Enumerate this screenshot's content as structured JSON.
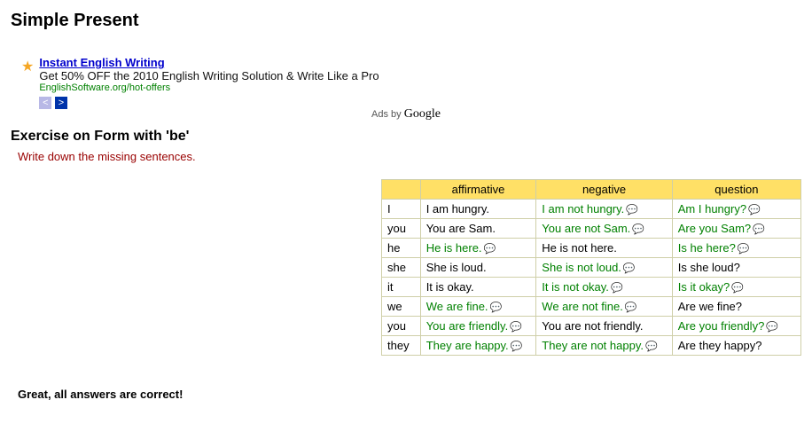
{
  "page": {
    "title": "Simple Present",
    "subtitle": "Exercise on Form with 'be'",
    "instruction": "Write down the missing sentences.",
    "result": "Great, all answers are correct!"
  },
  "ad": {
    "title": "Instant English Writing",
    "desc": "Get 50% OFF the 2010 English Writing Solution & Write Like a Pro",
    "url": "EnglishSoftware.org/hot-offers",
    "prev": "<",
    "next": ">",
    "ads_by_prefix": "Ads by ",
    "ads_by_brand": "Google"
  },
  "table": {
    "headers": {
      "aff": "affirmative",
      "neg": "negative",
      "q": "question"
    },
    "rows": [
      {
        "p": "I",
        "aff": {
          "t": "I am hungry.",
          "ans": false,
          "b": false
        },
        "neg": {
          "t": "I am not hungry.",
          "ans": true,
          "b": true
        },
        "q": {
          "t": "Am I hungry?",
          "ans": true,
          "b": true
        }
      },
      {
        "p": "you",
        "aff": {
          "t": "You are Sam.",
          "ans": false,
          "b": false
        },
        "neg": {
          "t": "You are not Sam.",
          "ans": true,
          "b": true
        },
        "q": {
          "t": "Are you Sam?",
          "ans": true,
          "b": true
        }
      },
      {
        "p": "he",
        "aff": {
          "t": "He is here.",
          "ans": true,
          "b": true
        },
        "neg": {
          "t": "He is not here.",
          "ans": false,
          "b": false
        },
        "q": {
          "t": "Is he here?",
          "ans": true,
          "b": true
        }
      },
      {
        "p": "she",
        "aff": {
          "t": "She is loud.",
          "ans": false,
          "b": false
        },
        "neg": {
          "t": "She is not loud.",
          "ans": true,
          "b": true
        },
        "q": {
          "t": "Is she loud?",
          "ans": false,
          "b": false
        }
      },
      {
        "p": "it",
        "aff": {
          "t": "It is okay.",
          "ans": false,
          "b": false
        },
        "neg": {
          "t": "It is not okay.",
          "ans": true,
          "b": true
        },
        "q": {
          "t": "Is it okay?",
          "ans": true,
          "b": true
        }
      },
      {
        "p": "we",
        "aff": {
          "t": "We are fine.",
          "ans": true,
          "b": true
        },
        "neg": {
          "t": "We are not fine.",
          "ans": true,
          "b": true
        },
        "q": {
          "t": "Are we fine?",
          "ans": false,
          "b": false
        }
      },
      {
        "p": "you",
        "aff": {
          "t": "You are friendly.",
          "ans": true,
          "b": true
        },
        "neg": {
          "t": "You are not friendly.",
          "ans": false,
          "b": false
        },
        "q": {
          "t": "Are you friendly?",
          "ans": true,
          "b": true
        }
      },
      {
        "p": "they",
        "aff": {
          "t": "They are happy.",
          "ans": true,
          "b": true
        },
        "neg": {
          "t": "They are not happy.",
          "ans": true,
          "b": true
        },
        "q": {
          "t": "Are they happy?",
          "ans": false,
          "b": false
        }
      }
    ]
  }
}
